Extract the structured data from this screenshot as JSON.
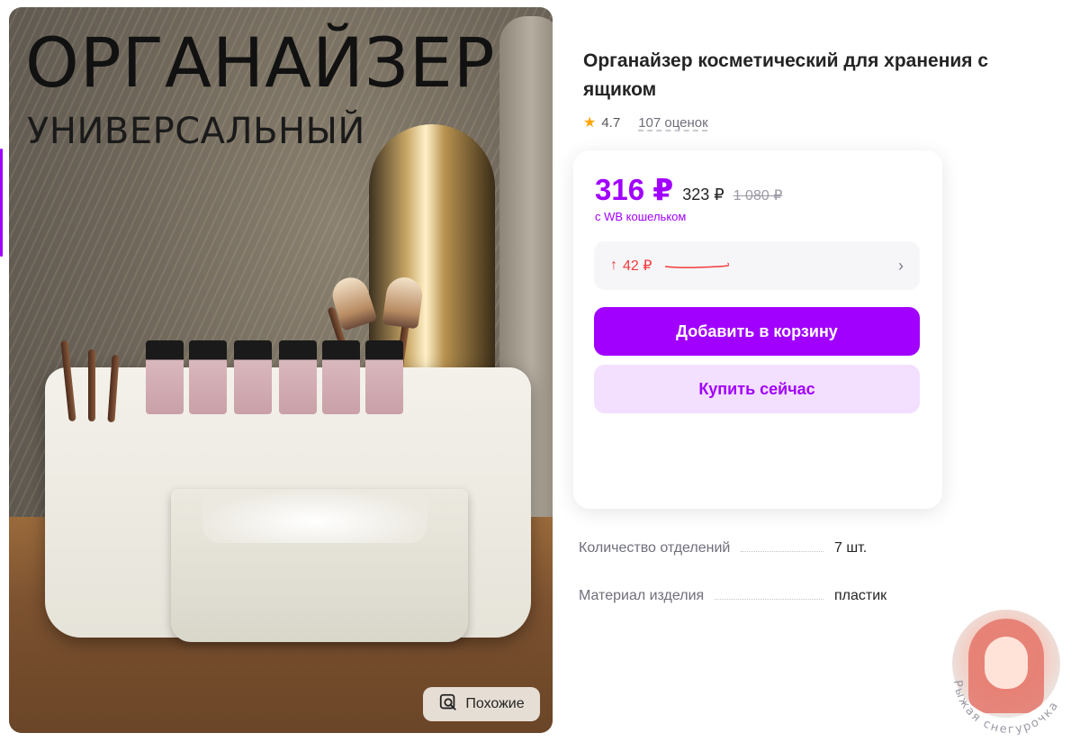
{
  "image": {
    "title_line1": "ОРГАНАЙЗЕР",
    "title_line2": "УНИВЕРСАЛЬНЫЙ",
    "similar_button": "Похожие"
  },
  "product": {
    "title": "Органайзер косметический для хранения с ящиком",
    "rating": "4.7",
    "reviews": "107 оценок"
  },
  "price": {
    "main": "316 ₽",
    "old": "323 ₽",
    "crossed": "1 080 ₽",
    "wallet_note": "с WB кошельком",
    "delta": "42 ₽"
  },
  "buttons": {
    "add_to_cart": "Добавить в корзину",
    "buy_now": "Купить сейчас"
  },
  "specs": [
    {
      "label": "Количество отделений",
      "value": "7 шт."
    },
    {
      "label": "Материал изделия",
      "value": "пластик"
    }
  ],
  "watermark": {
    "text": "Рыжая снегурочка"
  },
  "colors": {
    "accent": "#a100ff",
    "accent_light": "#f3dfff",
    "delta_red": "#f33b3b",
    "star": "#ffa600"
  }
}
